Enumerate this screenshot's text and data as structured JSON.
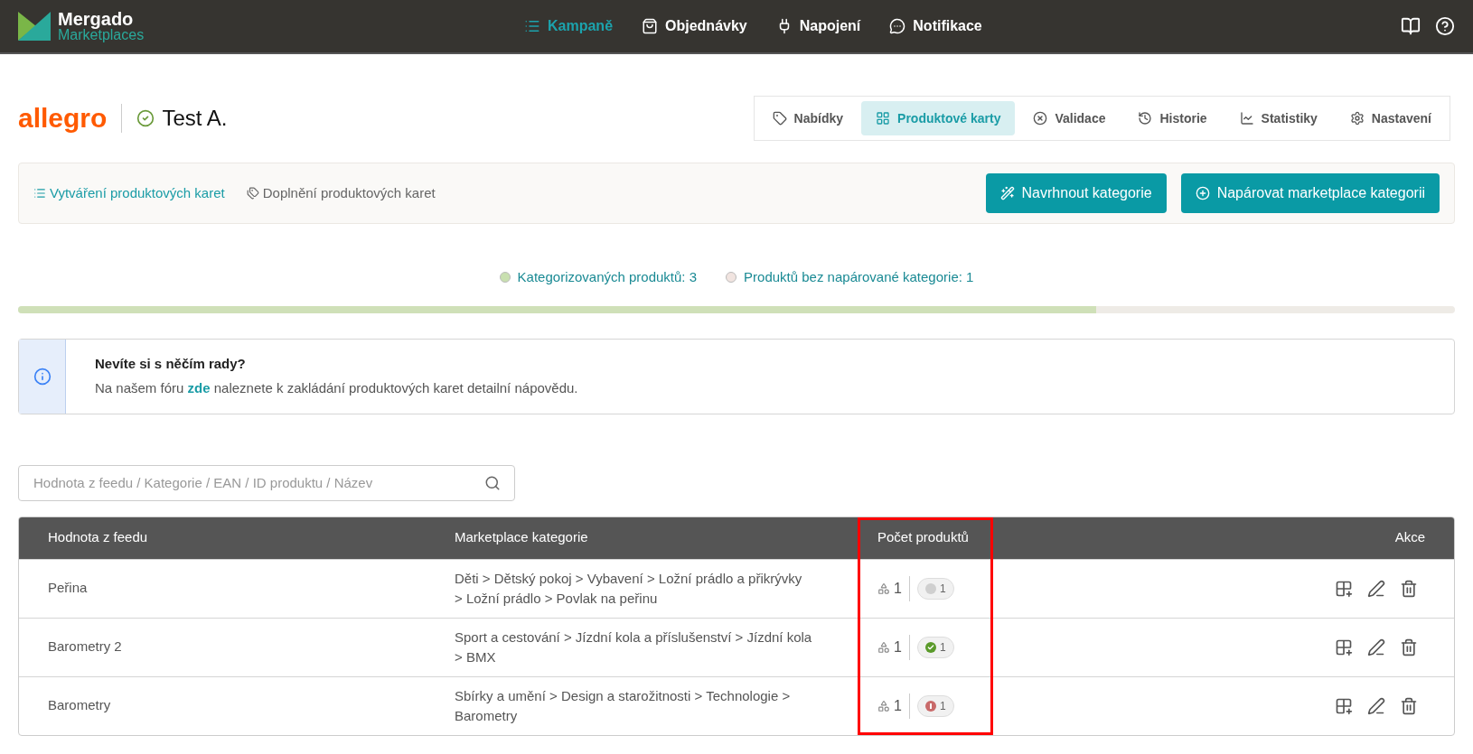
{
  "brand": {
    "name": "Mergado",
    "sub": "Marketplaces"
  },
  "nav": [
    {
      "label": "Kampaně",
      "selected": true
    },
    {
      "label": "Objednávky",
      "selected": false
    },
    {
      "label": "Napojení",
      "selected": false
    },
    {
      "label": "Notifikace",
      "selected": false
    }
  ],
  "marketplace": {
    "logo": "allegro",
    "shop": "Test A."
  },
  "tabs": [
    {
      "label": "Nabídky",
      "selected": false
    },
    {
      "label": "Produktové karty",
      "selected": true
    },
    {
      "label": "Validace",
      "selected": false
    },
    {
      "label": "Historie",
      "selected": false
    },
    {
      "label": "Statistiky",
      "selected": false
    },
    {
      "label": "Nastavení",
      "selected": false
    }
  ],
  "subnav": [
    {
      "label": "Vytváření produktových karet",
      "selected": true
    },
    {
      "label": "Doplnění produktových karet",
      "selected": false
    }
  ],
  "actions": [
    {
      "label": "Navrhnout kategorie"
    },
    {
      "label": "Napárovat marketplace kategorii"
    }
  ],
  "stats": [
    {
      "label": "Kategorizovaných produktů: 3",
      "color": "#c9e0b0"
    },
    {
      "label": "Produktů bez napárované kategorie: 1",
      "color": "#f1e4e0"
    }
  ],
  "progress": {
    "level": 0.75
  },
  "info": {
    "title": "Nevíte si s něčím rady?",
    "before": "Na našem fóru",
    "link": "zde",
    "after": "naleznete k zakládání produktových karet detailní nápovědu."
  },
  "search": {
    "placeholder": "Hodnota z feedu / Kategorie / EAN / ID produktu / Název"
  },
  "table": {
    "columns": [
      {
        "label": "Hodnota z feedu",
        "highlighted": false
      },
      {
        "label": "Marketplace kategorie",
        "highlighted": false
      },
      {
        "label": "Počet produktů",
        "highlighted": true
      },
      {
        "label": "Akce",
        "highlighted": false
      }
    ],
    "rows": [
      {
        "feed": "Peřina",
        "category": "Děti > Dětský pokoj > Vybavení > Ložní prádlo a přikrývky > Ložní prádlo > Povlak na peřinu",
        "count": "1",
        "kind": "neutral",
        "status_count": "1"
      },
      {
        "feed": "Barometry 2",
        "category": "Sport a cestování > Jízdní kola a příslušenství > Jízdní kola > BMX",
        "count": "1",
        "kind": "ok",
        "status_count": "1"
      },
      {
        "feed": "Barometry",
        "category": "Sbírky a umění > Design a starožitnosti > Technologie > Barometry",
        "count": "1",
        "kind": "error",
        "status_count": "1"
      }
    ]
  }
}
